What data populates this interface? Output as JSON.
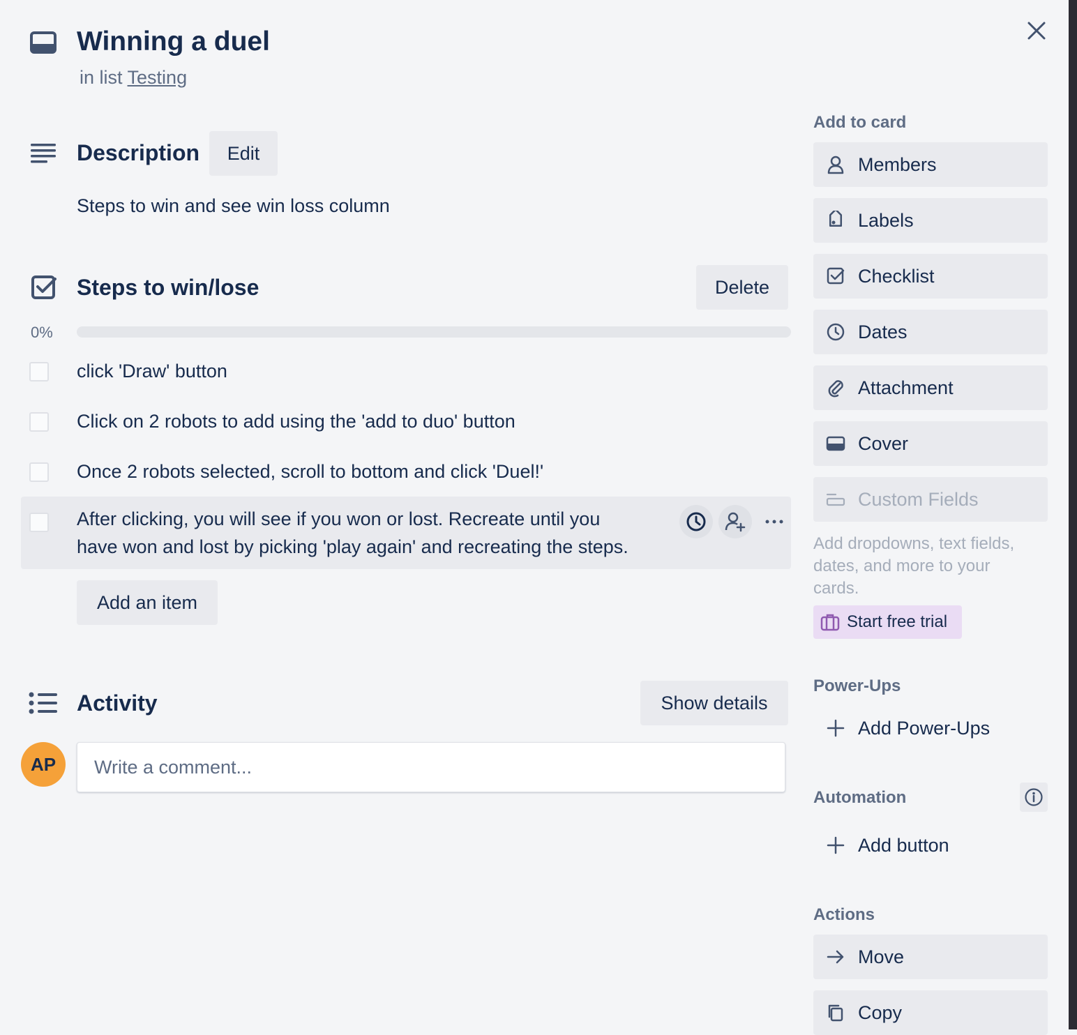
{
  "card": {
    "title": "Winning a duel",
    "list_prefix": "in list",
    "list_name": "Testing",
    "close_icon": "close-icon"
  },
  "description": {
    "heading": "Description",
    "edit_label": "Edit",
    "text": "Steps to win and see win loss column"
  },
  "checklist": {
    "heading": "Steps to win/lose",
    "delete_label": "Delete",
    "progress_label": "0%",
    "progress_fraction": 0,
    "items": [
      {
        "text": "click 'Draw' button",
        "checked": false
      },
      {
        "text": "Click on 2 robots to add using the 'add to duo' button",
        "checked": false
      },
      {
        "text": "Once 2 robots selected, scroll to bottom and click 'Duel!'",
        "checked": false
      },
      {
        "text_line1": "After clicking, you will see if you won or lost. Recreate until you",
        "text_line2": "have won and lost by picking 'play again' and recreating the steps.",
        "checked": false
      }
    ],
    "add_item_label": "Add an item"
  },
  "activity": {
    "heading": "Activity",
    "show_details_label": "Show details",
    "avatar_initials": "AP",
    "comment_placeholder": "Write a comment..."
  },
  "sidebar": {
    "add_to_card_heading": "Add to card",
    "add_to_card": [
      {
        "label": "Members",
        "icon": "person-icon"
      },
      {
        "label": "Labels",
        "icon": "tag-icon"
      },
      {
        "label": "Checklist",
        "icon": "checkbox-icon"
      },
      {
        "label": "Dates",
        "icon": "clock-icon"
      },
      {
        "label": "Attachment",
        "icon": "paperclip-icon"
      },
      {
        "label": "Cover",
        "icon": "cover-icon"
      },
      {
        "label": "Custom Fields",
        "icon": "custom-fields-icon"
      }
    ],
    "custom_fields_desc_1": "Add dropdowns, text fields,",
    "custom_fields_desc_2": "dates, and more to your",
    "custom_fields_desc_3": "cards.",
    "trial_label": "Start free trial",
    "powerups_heading": "Power-Ups",
    "add_powerups_label": "Add Power-Ups",
    "automation_heading": "Automation",
    "add_button_label": "Add button",
    "actions_heading": "Actions",
    "actions": [
      {
        "label": "Move",
        "icon": "arrow-right-icon"
      },
      {
        "label": "Copy",
        "icon": "copy-icon"
      }
    ]
  },
  "colors": {
    "background": "#f4f5f7",
    "text": "#172b4d",
    "muted": "#5e6c84",
    "button_bg": "#e9eaee",
    "avatar": "#f5a139",
    "trial_bg": "#eadcf4"
  }
}
